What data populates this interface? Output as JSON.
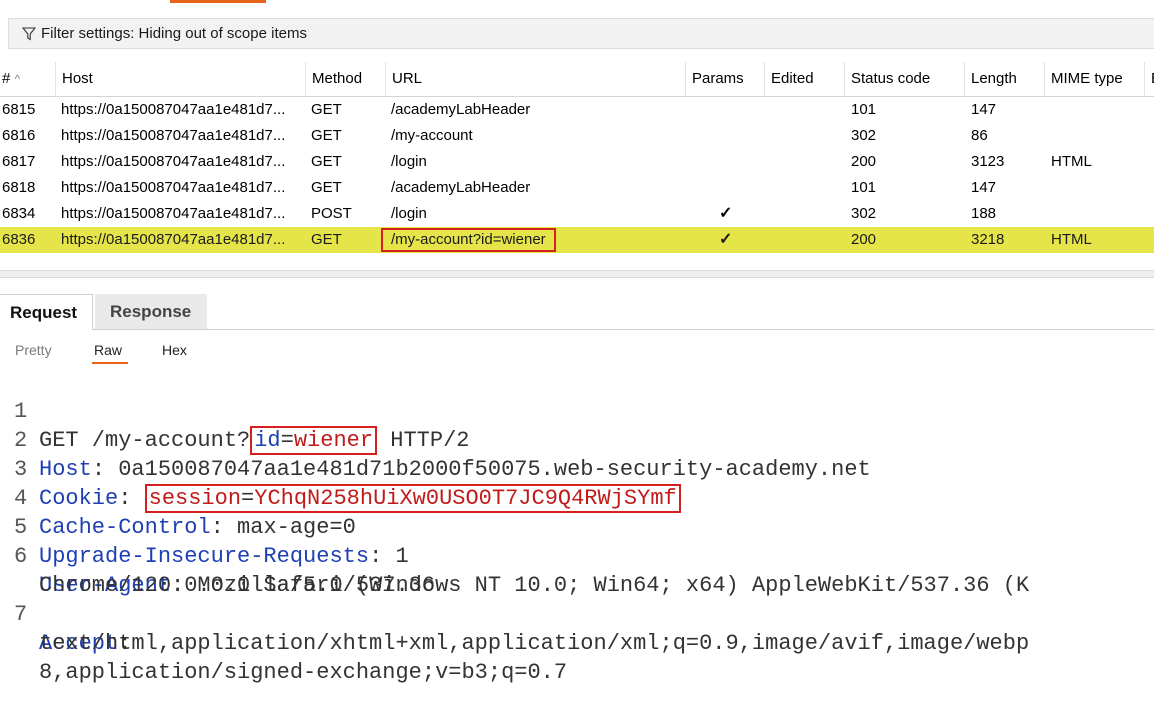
{
  "filter": {
    "label": "Filter settings: Hiding out of scope items"
  },
  "table": {
    "columns": [
      "#",
      "Host",
      "Method",
      "URL",
      "Params",
      "Edited",
      "Status code",
      "Length",
      "MIME type",
      "E"
    ],
    "sort_indicator": "^",
    "rows": [
      {
        "num": "6815",
        "host": "https://0a150087047aa1e481d7...",
        "method": "GET",
        "url": "/academyLabHeader",
        "params": "",
        "status": "101",
        "length": "147",
        "mime": ""
      },
      {
        "num": "6816",
        "host": "https://0a150087047aa1e481d7...",
        "method": "GET",
        "url": "/my-account",
        "params": "",
        "status": "302",
        "length": "86",
        "mime": ""
      },
      {
        "num": "6817",
        "host": "https://0a150087047aa1e481d7...",
        "method": "GET",
        "url": "/login",
        "params": "",
        "status": "200",
        "length": "3123",
        "mime": "HTML"
      },
      {
        "num": "6818",
        "host": "https://0a150087047aa1e481d7...",
        "method": "GET",
        "url": "/academyLabHeader",
        "params": "",
        "status": "101",
        "length": "147",
        "mime": ""
      },
      {
        "num": "6834",
        "host": "https://0a150087047aa1e481d7...",
        "method": "POST",
        "url": "/login",
        "params": "✓",
        "status": "302",
        "length": "188",
        "mime": ""
      },
      {
        "num": "6836",
        "host": "https://0a150087047aa1e481d7...",
        "method": "GET",
        "url": "/my-account?id=wiener",
        "params": "✓",
        "status": "200",
        "length": "3218",
        "mime": "HTML"
      }
    ]
  },
  "tabs": {
    "request": "Request",
    "response": "Response"
  },
  "subtabs": {
    "pretty": "Pretty",
    "raw": "Raw",
    "hex": "Hex"
  },
  "request": {
    "lines": [
      {
        "n": "1",
        "a": "GET /my-account?",
        "k": "id",
        "eq": "=",
        "v": "wiener",
        "b": " HTTP/2"
      },
      {
        "n": "2",
        "k": "Host",
        "rest": ": 0a150087047aa1e481d71b2000f50075.web-security-academy.net"
      },
      {
        "n": "3",
        "k": "Cookie",
        "sep": ": ",
        "ck": "session",
        "eq": "=",
        "cv": "YChqN258hUiXw0USO0T7JC9Q4RWjSYmf"
      },
      {
        "n": "4",
        "k": "Cache-Control",
        "rest": ": max-age=0"
      },
      {
        "n": "5",
        "k": "Upgrade-Insecure-Requests",
        "rest": ": 1"
      },
      {
        "n": "6",
        "k": "User-Agent",
        "rest": ": Mozilla/5.0 (Windows NT 10.0; Win64; x64) AppleWebKit/537.36 (K",
        "cont": "Chrome/120.0.0.0 Safari/537.36"
      },
      {
        "n": "7",
        "k": "Accept",
        "rest": ":",
        "cont": "text/html,application/xhtml+xml,application/xml;q=0.9,image/avif,image/webp",
        "cont2": "8,application/signed-exchange;v=b3;q=0.7"
      }
    ]
  },
  "colors": {
    "selected_row": "#e5e54a",
    "highlight_box": "#d62020",
    "accent": "#e8631a",
    "header_key": "#1f3fb3",
    "value": "#c01b1b"
  }
}
